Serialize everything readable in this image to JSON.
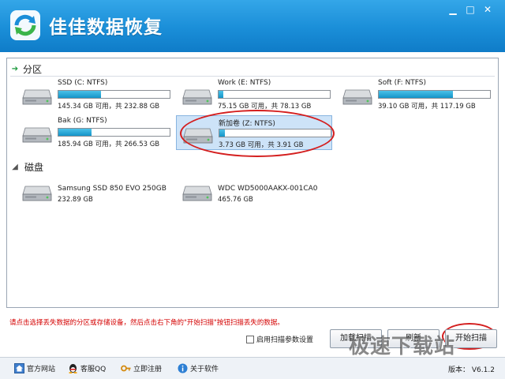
{
  "app": {
    "title": "佳佳数据恢复"
  },
  "window_controls": {
    "minimize": "▁",
    "maximize": "□",
    "close": "✕"
  },
  "groups": {
    "partitions": "分区",
    "disks": "磁盘"
  },
  "partitions": [
    {
      "name": "SSD (C: NTFS)",
      "sizes": "145.34 GB 可用，共 232.88 GB",
      "used_fraction": 0.38,
      "selected": false
    },
    {
      "name": "Work (E: NTFS)",
      "sizes": "75.15 GB 可用，共 78.13 GB",
      "used_fraction": 0.04,
      "selected": false
    },
    {
      "name": "Soft (F: NTFS)",
      "sizes": "39.10 GB 可用，共 117.19 GB",
      "used_fraction": 0.67,
      "selected": false
    },
    {
      "name": "Bak (G: NTFS)",
      "sizes": "185.94 GB 可用，共 266.53 GB",
      "used_fraction": 0.3,
      "selected": false
    },
    {
      "name": "新加卷 (Z: NTFS)",
      "sizes": "3.73 GB 可用，共 3.91 GB",
      "used_fraction": 0.05,
      "selected": true
    }
  ],
  "disks": [
    {
      "name": "Samsung SSD 850 EVO 250GB",
      "sizes": "232.89 GB"
    },
    {
      "name": "WDC WD5000AAKX-001CA0",
      "sizes": "465.76 GB"
    }
  ],
  "hint": "请点击选择丢失数据的分区或存储设备，然后点击右下角的\"开始扫描\"按钮扫描丢失的数据。",
  "options": {
    "scan_settings_label": "启用扫描参数设置",
    "scan_settings_checked": false
  },
  "buttons": {
    "load": "加载扫描",
    "refresh": "刷新",
    "scan": "开始扫描"
  },
  "footer": {
    "links": [
      "官方网站",
      "客服QQ",
      "立即注册",
      "关于软件"
    ],
    "version": "版本： V6.1.2"
  },
  "watermark": "极速下载站",
  "colors": {
    "titlebar": "#1a8ed8",
    "bar_fill": "#1495c8",
    "annotation": "#d41f1f",
    "hint_text": "#d40000"
  }
}
